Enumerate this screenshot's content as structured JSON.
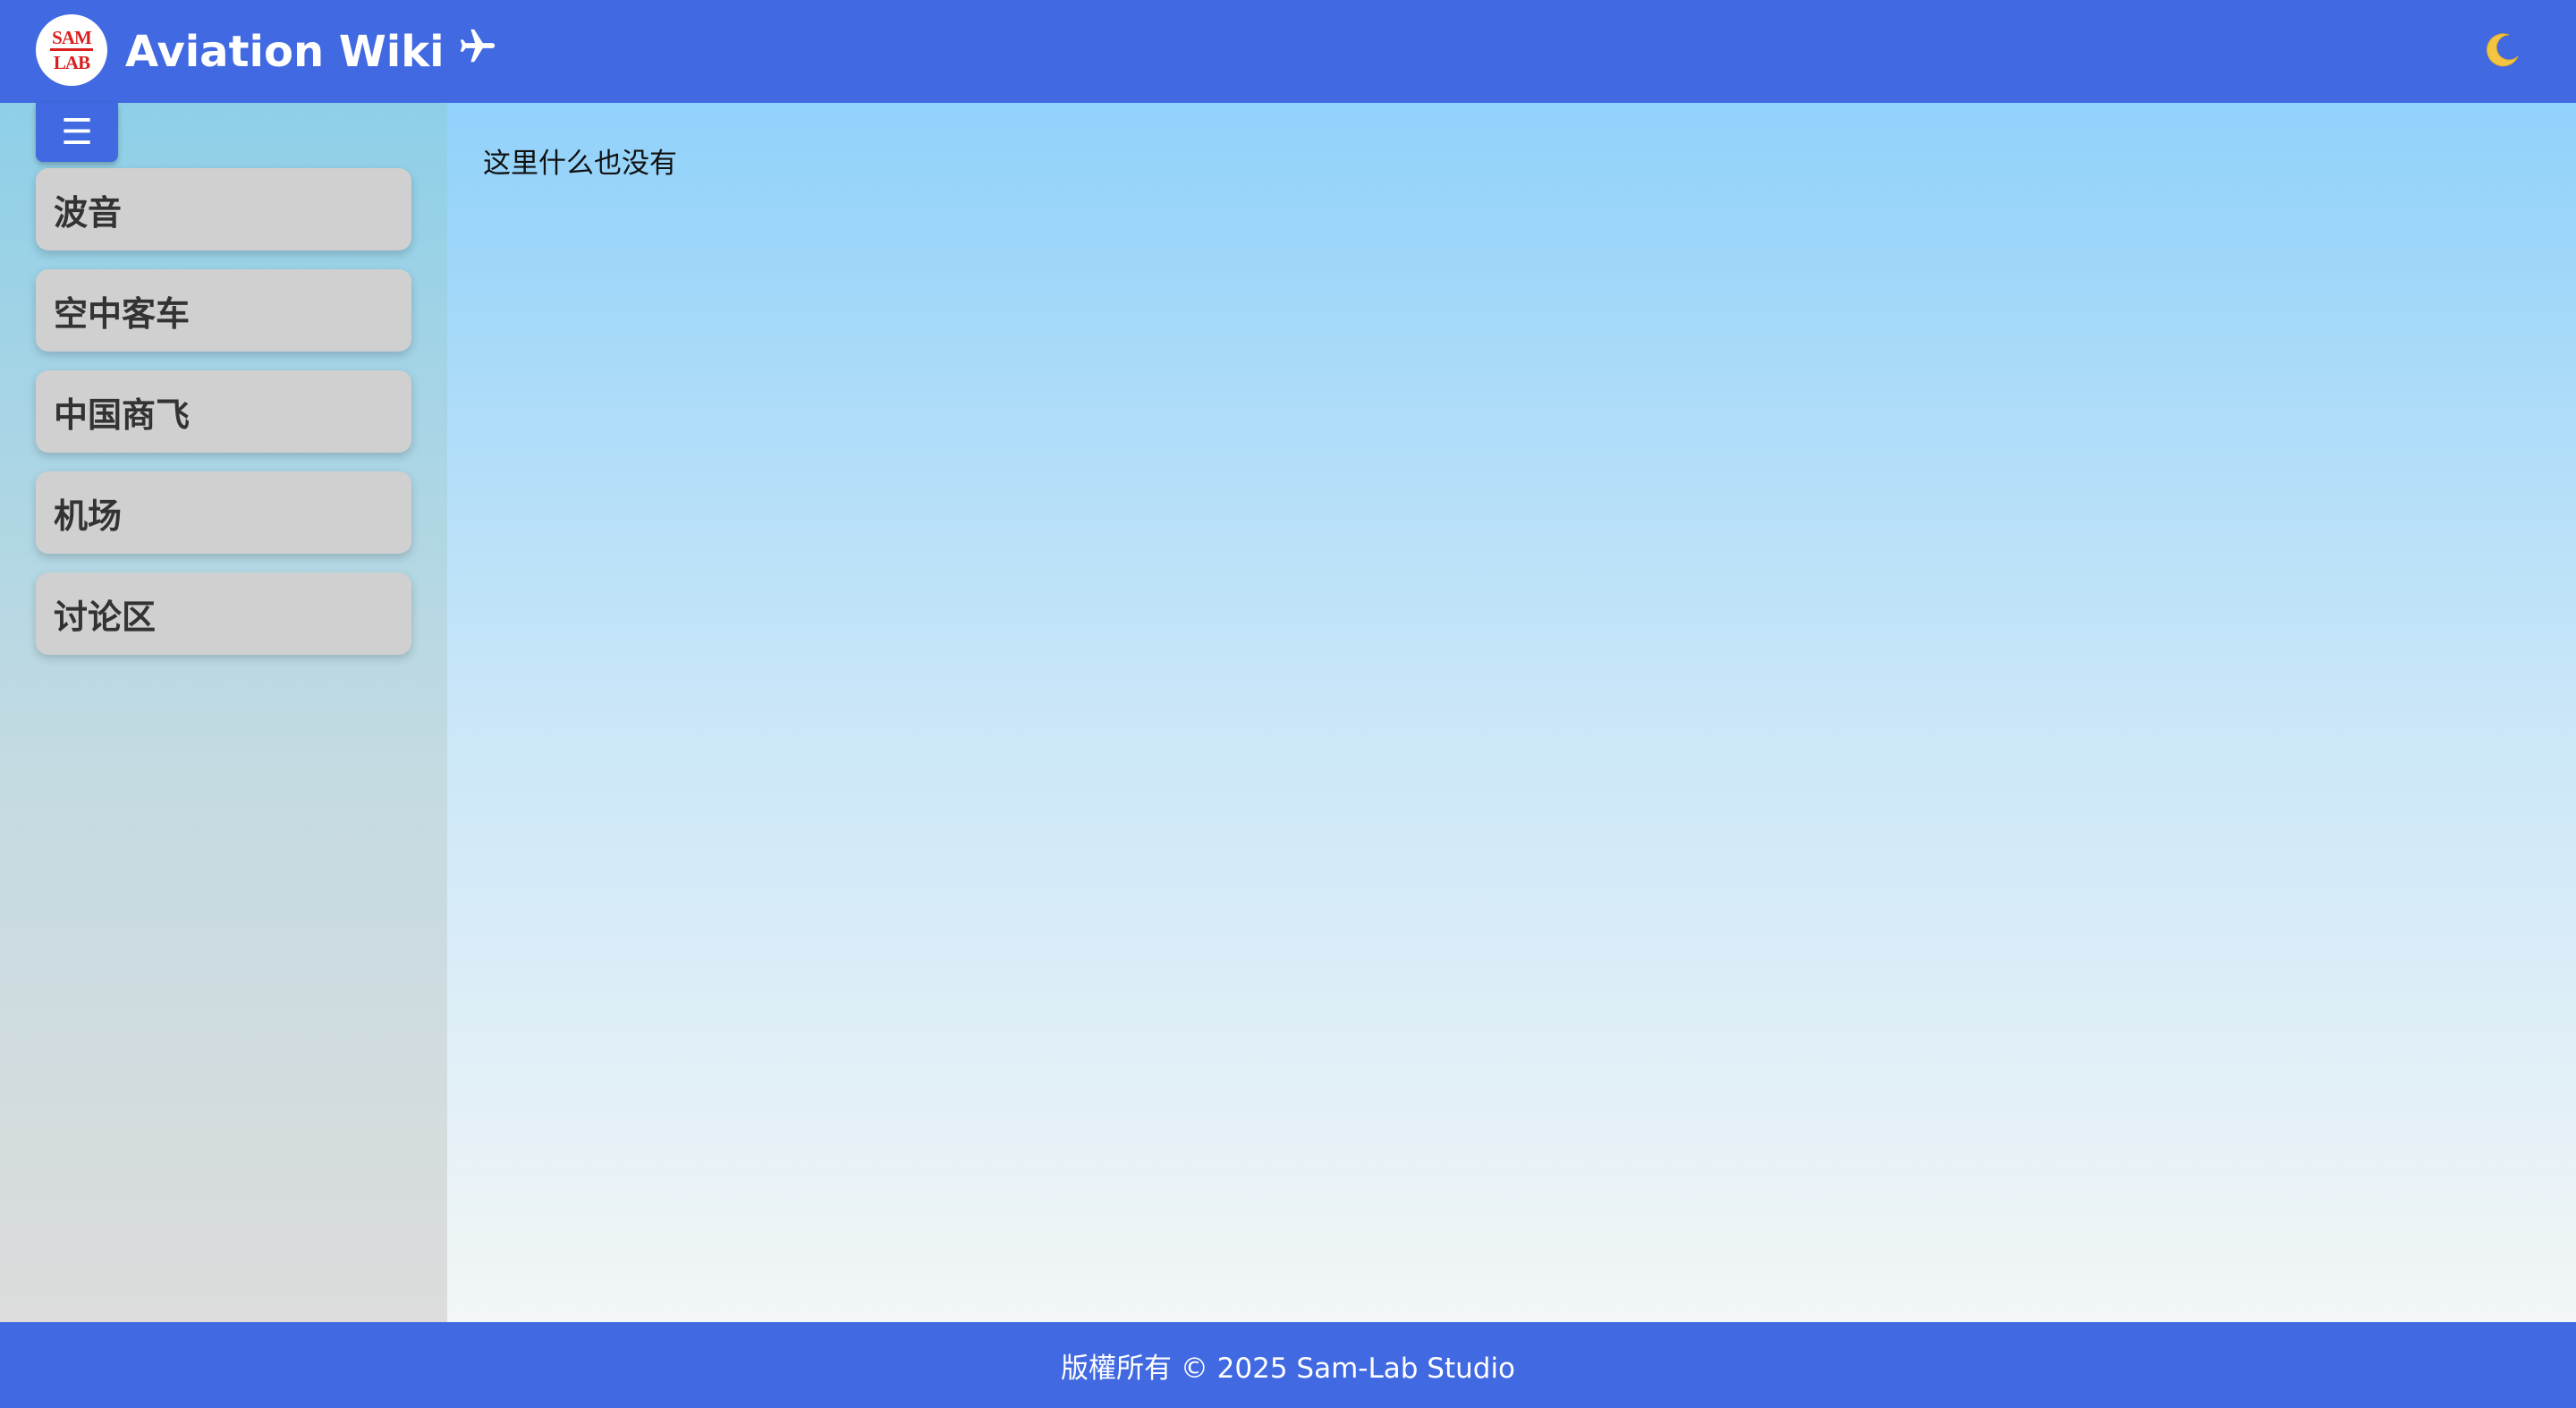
{
  "header": {
    "logo": {
      "line1": "SAM",
      "line2": "LAB"
    },
    "title": "Aviation Wiki",
    "title_icon": "airplane-icon",
    "theme_toggle_icon": "moon-icon"
  },
  "sidebar": {
    "menu_toggle_icon": "hamburger-menu-icon",
    "menu_toggle_glyph": "☰",
    "items": [
      {
        "label": "波音"
      },
      {
        "label": "空中客车"
      },
      {
        "label": "中国商飞"
      },
      {
        "label": "机场"
      },
      {
        "label": "讨论区"
      }
    ]
  },
  "main": {
    "message": "这里什么也没有"
  },
  "footer": {
    "copyright": "版權所有 © 2025 Sam-Lab Studio"
  },
  "colors": {
    "brand_blue": "#4169E1",
    "nav_item_bg": "#d0d0d0",
    "logo_red": "#d81e1e",
    "moon_yellow": "#f4c542"
  }
}
